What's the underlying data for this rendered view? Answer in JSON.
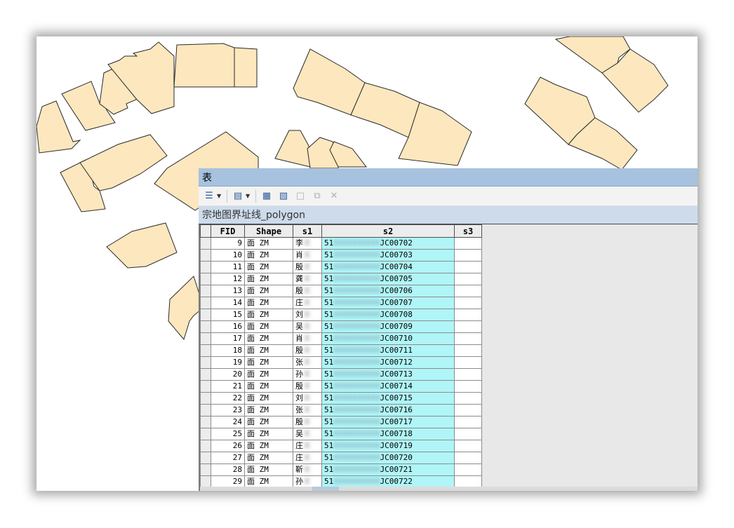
{
  "window": {
    "title": "表",
    "layer_tab": "宗地图界址线_polygon"
  },
  "toolbar": {
    "buttons": [
      {
        "icon": "table-options-icon",
        "glyph": "☰"
      },
      {
        "icon": "related-tables-icon",
        "glyph": "▤"
      },
      {
        "icon": "select-by-attributes-icon",
        "glyph": "▦"
      },
      {
        "icon": "switch-selection-icon",
        "glyph": "▧"
      },
      {
        "icon": "clear-selection-icon",
        "glyph": "□"
      },
      {
        "icon": "zoom-to-selected-icon",
        "glyph": "⧉"
      },
      {
        "icon": "delete-selected-icon",
        "glyph": "✕"
      }
    ]
  },
  "table": {
    "columns": [
      "FID",
      "Shape",
      "s1",
      "s2",
      "s3"
    ],
    "rows": [
      {
        "fid": "9",
        "shape": "面 ZM",
        "s1": "李",
        "s2_prefix": "51",
        "s2_suffix": "JC00702"
      },
      {
        "fid": "10",
        "shape": "面 ZM",
        "s1": "肖",
        "s2_prefix": "51",
        "s2_suffix": "JC00703"
      },
      {
        "fid": "11",
        "shape": "面 ZM",
        "s1": "殷",
        "s2_prefix": "51",
        "s2_suffix": "JC00704"
      },
      {
        "fid": "12",
        "shape": "面 ZM",
        "s1": "龚",
        "s2_prefix": "51",
        "s2_suffix": "JC00705"
      },
      {
        "fid": "13",
        "shape": "面 ZM",
        "s1": "殷",
        "s2_prefix": "51",
        "s2_suffix": "JC00706"
      },
      {
        "fid": "14",
        "shape": "面 ZM",
        "s1": "庄",
        "s2_prefix": "51",
        "s2_suffix": "JC00707"
      },
      {
        "fid": "15",
        "shape": "面 ZM",
        "s1": "刘",
        "s2_prefix": "51",
        "s2_suffix": "JC00708"
      },
      {
        "fid": "16",
        "shape": "面 ZM",
        "s1": "吴",
        "s2_prefix": "51",
        "s2_suffix": "JC00709"
      },
      {
        "fid": "17",
        "shape": "面 ZM",
        "s1": "肖",
        "s2_prefix": "51",
        "s2_suffix": "JC00710"
      },
      {
        "fid": "18",
        "shape": "面 ZM",
        "s1": "殷",
        "s2_prefix": "51",
        "s2_suffix": "JC00711"
      },
      {
        "fid": "19",
        "shape": "面 ZM",
        "s1": "张",
        "s2_prefix": "51",
        "s2_suffix": "JC00712"
      },
      {
        "fid": "20",
        "shape": "面 ZM",
        "s1": "孙",
        "s2_prefix": "51",
        "s2_suffix": "JC00713"
      },
      {
        "fid": "21",
        "shape": "面 ZM",
        "s1": "殷",
        "s2_prefix": "51",
        "s2_suffix": "JC00714"
      },
      {
        "fid": "22",
        "shape": "面 ZM",
        "s1": "刘",
        "s2_prefix": "51",
        "s2_suffix": "JC00715"
      },
      {
        "fid": "23",
        "shape": "面 ZM",
        "s1": "张",
        "s2_prefix": "51",
        "s2_suffix": "JC00716"
      },
      {
        "fid": "24",
        "shape": "面 ZM",
        "s1": "殷",
        "s2_prefix": "51",
        "s2_suffix": "JC00717"
      },
      {
        "fid": "25",
        "shape": "面 ZM",
        "s1": "吴",
        "s2_prefix": "51",
        "s2_suffix": "JC00718"
      },
      {
        "fid": "26",
        "shape": "面 ZM",
        "s1": "庄",
        "s2_prefix": "51",
        "s2_suffix": "JC00719"
      },
      {
        "fid": "27",
        "shape": "面 ZM",
        "s1": "庄",
        "s2_prefix": "51",
        "s2_suffix": "JC00720"
      },
      {
        "fid": "28",
        "shape": "面 ZM",
        "s1": "靳",
        "s2_prefix": "51",
        "s2_suffix": "JC00721"
      },
      {
        "fid": "29",
        "shape": "面 ZM",
        "s1": "孙",
        "s2_prefix": "51",
        "s2_suffix": "JC00722"
      }
    ]
  },
  "colors": {
    "parcel_fill": "#fde7be",
    "parcel_stroke": "#2a2a2a",
    "selected_column": "#b0f5f7",
    "title_bar": "#a7c2de"
  }
}
